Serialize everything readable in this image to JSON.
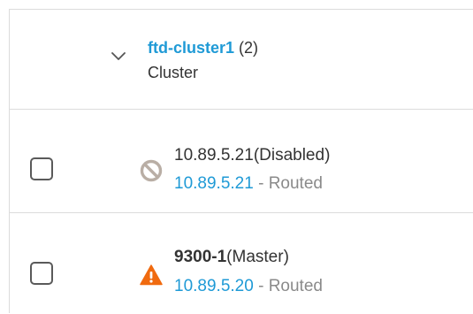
{
  "cluster": {
    "name": "ftd-cluster1",
    "count": "(2)",
    "type_label": "Cluster"
  },
  "devices": [
    {
      "name": "10.89.5.21",
      "status": "(Disabled)",
      "ip": "10.89.5.21",
      "separator": " - ",
      "mode": "Routed",
      "status_icon": "disabled-icon",
      "status_color": "#b9aea5"
    },
    {
      "name": "9300-1",
      "status": "(Master)",
      "ip": "10.89.5.20",
      "separator": " - ",
      "mode": "Routed",
      "status_icon": "warning-icon",
      "status_color": "#f06a0f"
    }
  ],
  "colors": {
    "link": "#1f9ad6",
    "text": "#333333",
    "muted": "#8a8a8a",
    "border": "#dcdcdc"
  }
}
